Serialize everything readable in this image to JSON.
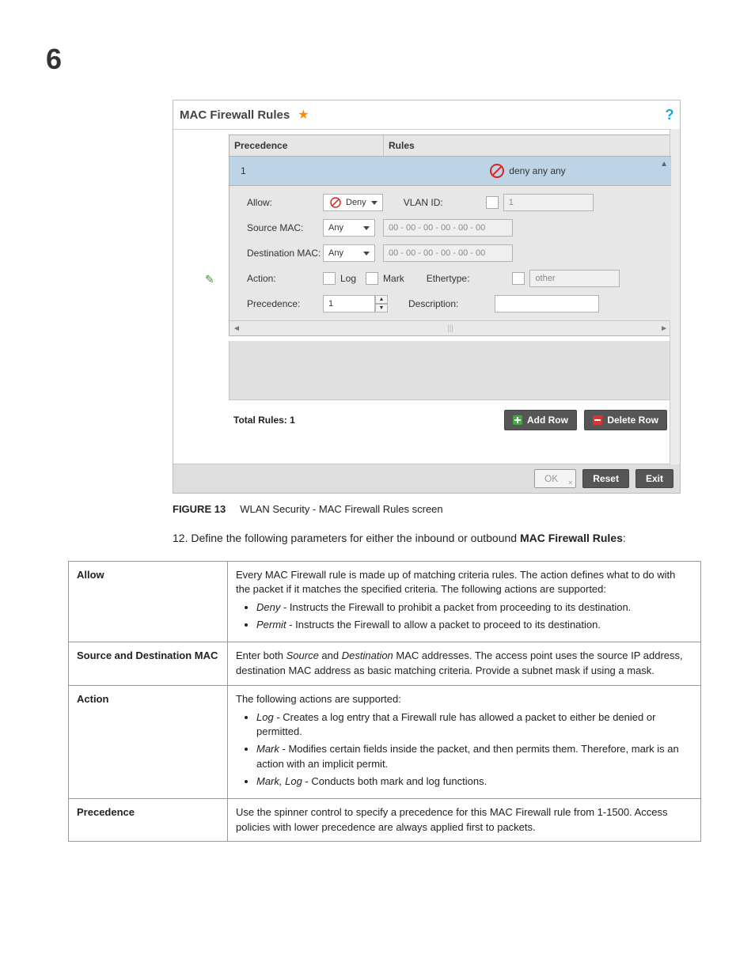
{
  "chapter_number": "6",
  "screenshot": {
    "panel_title": "MAC Firewall Rules",
    "columns": {
      "precedence": "Precedence",
      "rules": "Rules"
    },
    "rule_row": {
      "precedence": "1",
      "summary": "deny any any"
    },
    "fields": {
      "allow_label": "Allow:",
      "allow_value": "Deny",
      "vlan_label": "VLAN ID:",
      "vlan_value": "1",
      "src_label": "Source MAC:",
      "src_mode": "Any",
      "src_value": "00 - 00 - 00 - 00 - 00 - 00",
      "dst_label": "Destination MAC:",
      "dst_mode": "Any",
      "dst_value": "00 - 00 - 00 - 00 - 00 - 00",
      "action_label": "Action:",
      "action_log": "Log",
      "action_mark": "Mark",
      "ether_label": "Ethertype:",
      "ether_value": "other",
      "prec_label": "Precedence:",
      "prec_value": "1",
      "desc_label": "Description:"
    },
    "total_rules": "Total Rules: 1",
    "buttons": {
      "add": "Add Row",
      "del": "Delete Row",
      "ok": "OK",
      "reset": "Reset",
      "exit": "Exit"
    }
  },
  "figure": {
    "label": "FIGURE 13",
    "caption": "WLAN Security - MAC Firewall Rules screen"
  },
  "step": {
    "num": "12.",
    "text_a": "Define the following parameters for either the inbound or outbound ",
    "text_b": "MAC Firewall Rules",
    "text_c": ":"
  },
  "table": {
    "allow": {
      "k": "Allow",
      "intro": "Every MAC Firewall rule is made up of matching criteria rules. The action defines what to do with the packet if it matches the specified criteria. The following actions are supported:",
      "b1a": "Deny",
      "b1b": " - Instructs the Firewall to prohibit a packet from proceeding to its destination.",
      "b2a": "Permit",
      "b2b": " - Instructs the Firewall to allow a packet to proceed to its destination."
    },
    "sdmac": {
      "k": "Source and Destination MAC",
      "v_a": "Enter both ",
      "v_b": "Source",
      "v_c": " and ",
      "v_d": "Destination",
      "v_e": " MAC addresses. The access point uses the source IP address, destination MAC address as basic matching criteria. Provide a subnet mask if using a mask."
    },
    "action": {
      "k": "Action",
      "intro": "The following actions are supported:",
      "b1a": "Log",
      "b1b": " - Creates a log entry that a Firewall rule has allowed a packet to either be denied or permitted.",
      "b2a": "Mark",
      "b2b": " - Modifies certain fields inside the packet, and then permits them. Therefore, mark is an action with an implicit permit.",
      "b3a": "Mark, Log",
      "b3b": " - Conducts both mark and log functions."
    },
    "prec": {
      "k": "Precedence",
      "v": "Use the spinner control to specify a precedence for this MAC Firewall rule from 1-1500. Access policies with lower precedence are always applied first to packets."
    }
  }
}
